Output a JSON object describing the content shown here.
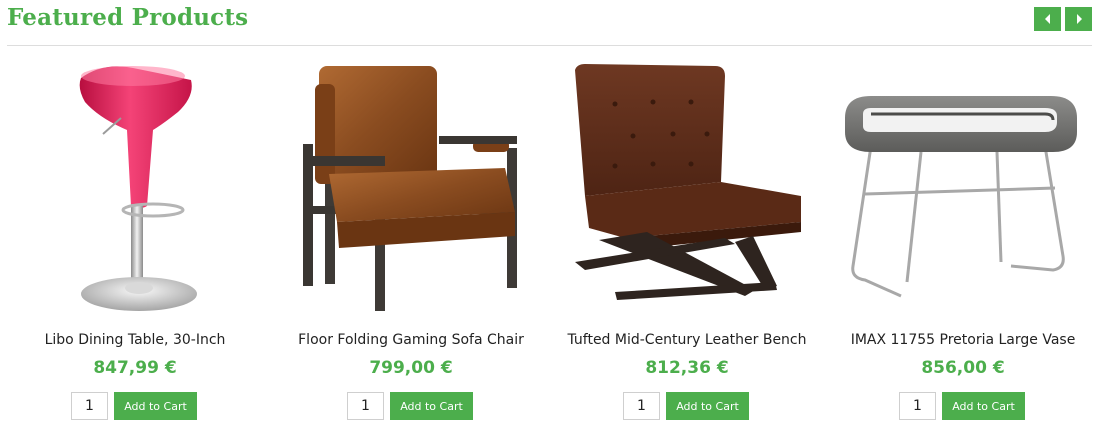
{
  "header": {
    "title": "Featured Products",
    "prev_icon": "chevron-left-icon",
    "next_icon": "chevron-right-icon"
  },
  "colors": {
    "accent": "#4cae4c",
    "price": "#4cae4c"
  },
  "products": [
    {
      "name": "Libo Dining Table, 30-Inch",
      "price": "847,99 €",
      "qty": "1",
      "cart_label": "Add to Cart",
      "image": "pink-bar-stool"
    },
    {
      "name": "Floor Folding Gaming Sofa Chair",
      "price": "799,00 €",
      "qty": "1",
      "cart_label": "Add to Cart",
      "image": "brown-leather-armchair"
    },
    {
      "name": "Tufted Mid-Century Leather Bench",
      "price": "812,36 €",
      "qty": "1",
      "cart_label": "Add to Cart",
      "image": "tufted-leather-chair"
    },
    {
      "name": "IMAX 11755 Pretoria Large Vase",
      "price": "856,00 €",
      "qty": "1",
      "cart_label": "Add to Cart",
      "image": "grey-side-table"
    }
  ]
}
